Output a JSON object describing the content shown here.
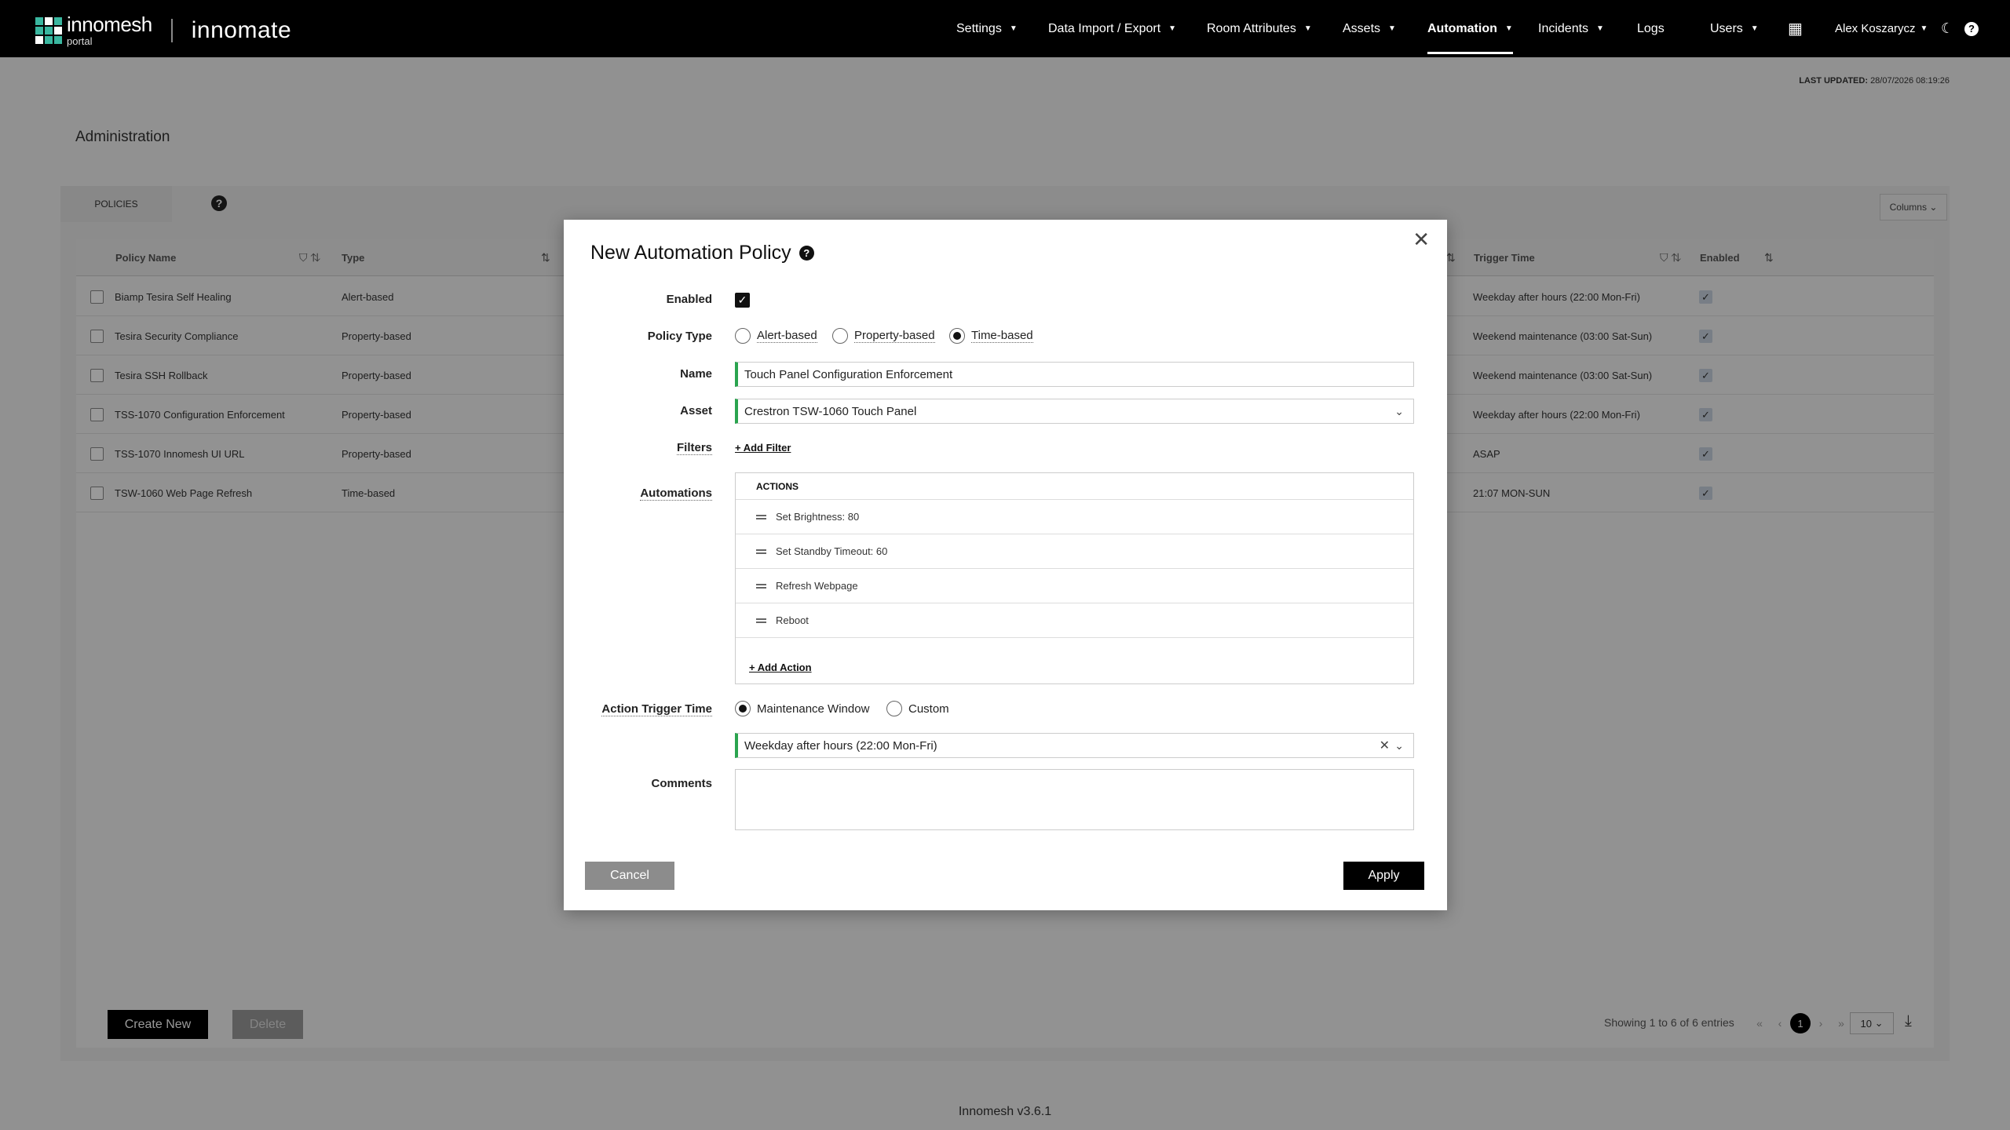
{
  "app": {
    "brand_innomesh": "innomesh",
    "brand_portal": "portal",
    "brand_innomate": "innomate",
    "version": "Innomesh v3.6.1"
  },
  "nav": {
    "items": [
      {
        "label": "Settings",
        "caret": true
      },
      {
        "label": "Data Import / Export",
        "caret": true
      },
      {
        "label": "Room Attributes",
        "caret": true
      },
      {
        "label": "Assets",
        "caret": true
      },
      {
        "label": "Automation",
        "caret": true,
        "active": true
      },
      {
        "label": "Incidents",
        "caret": true
      },
      {
        "label": "Logs",
        "caret": false
      },
      {
        "label": "Users",
        "caret": true
      }
    ],
    "user": "Alex Koszarycz"
  },
  "last_updated": {
    "label": "LAST UPDATED:",
    "value": "28/07/2026 08:19:26"
  },
  "page": {
    "title": "Administration",
    "tab": "POLICIES",
    "columns_btn": "Columns"
  },
  "table": {
    "headers": {
      "name": "Policy Name",
      "type": "Type",
      "trigger": "Trigger Time",
      "enabled": "Enabled"
    },
    "rows": [
      {
        "name": "Biamp Tesira Self Healing",
        "type": "Alert-based",
        "trigger": "Weekday after hours (22:00 Mon-Fri)",
        "enabled": true
      },
      {
        "name": "Tesira Security Compliance",
        "type": "Property-based",
        "trigger": "Weekend maintenance (03:00 Sat-Sun)",
        "enabled": true
      },
      {
        "name": "Tesira SSH Rollback",
        "type": "Property-based",
        "trigger": "Weekend maintenance (03:00 Sat-Sun)",
        "enabled": true
      },
      {
        "name": "TSS-1070 Configuration Enforcement",
        "type": "Property-based",
        "trigger": "Weekday after hours (22:00 Mon-Fri)",
        "enabled": true
      },
      {
        "name": "TSS-1070 Innomesh UI URL",
        "type": "Property-based",
        "trigger": "ASAP",
        "enabled": true
      },
      {
        "name": "TSW-1060 Web Page Refresh",
        "type": "Time-based",
        "trigger": "21:07 MON-SUN",
        "enabled": true
      }
    ]
  },
  "buttons": {
    "create": "Create New",
    "delete": "Delete"
  },
  "pager": {
    "info": "Showing 1 to 6 of 6 entries",
    "current": "1",
    "per_page": "10"
  },
  "modal": {
    "title": "New Automation Policy",
    "labels": {
      "enabled": "Enabled",
      "policy_type": "Policy Type",
      "name": "Name",
      "asset": "Asset",
      "filters": "Filters",
      "automations": "Automations",
      "trigger": "Action Trigger Time",
      "comments": "Comments"
    },
    "policy_types": [
      {
        "label": "Alert-based",
        "selected": false
      },
      {
        "label": "Property-based",
        "selected": false
      },
      {
        "label": "Time-based",
        "selected": true
      }
    ],
    "name_value": "Touch Panel Configuration Enforcement",
    "asset_value": "Crestron TSW-1060 Touch Panel",
    "add_filter": "+ Add Filter",
    "actions_header": "ACTIONS",
    "actions": [
      "Set Brightness: 80",
      "Set Standby Timeout: 60",
      "Refresh Webpage",
      "Reboot"
    ],
    "add_action": "+ Add Action",
    "trigger_options": [
      {
        "label": "Maintenance Window",
        "selected": true
      },
      {
        "label": "Custom",
        "selected": false
      }
    ],
    "trigger_value": "Weekday after hours (22:00 Mon-Fri)",
    "comments_value": "",
    "cancel": "Cancel",
    "apply": "Apply"
  },
  "colors": {
    "accent_green": "#2aa44f",
    "brand_teal": "#3ab7a0"
  }
}
